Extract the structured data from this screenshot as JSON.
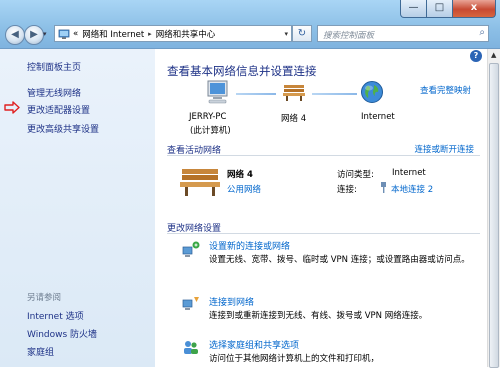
{
  "titlebar": {
    "min_label": "—",
    "max_label": "□",
    "close_label": "x"
  },
  "nav": {
    "back_label": "◀",
    "forward_label": "▶"
  },
  "address": {
    "root_label": "«",
    "segments": [
      "网络和 Internet",
      "网络和共享中心"
    ],
    "separator": "▸",
    "dropdown_label": "▾"
  },
  "refresh_label": "↻",
  "search": {
    "placeholder": "搜索控制面板",
    "icon": "magnifier-icon"
  },
  "sidebar": {
    "items": [
      "控制面板主页",
      "管理无线网络",
      "更改适配器设置",
      "更改高级共享设置"
    ],
    "see_also_title": "另请参阅",
    "see_also": [
      "Internet 选项",
      "Windows 防火墙",
      "家庭组"
    ],
    "arrow_color": "#e02020"
  },
  "main": {
    "title": "查看基本网络信息并设置连接",
    "full_map_link": "查看完整映射",
    "map": {
      "computer": "JERRY-PC",
      "computer_sub": "(此计算机)",
      "network": "网络 4",
      "internet": "Internet"
    },
    "active": {
      "header": "查看活动网络",
      "link": "连接或断开连接",
      "network_name": "网络 4",
      "network_type": "公用网络",
      "access_type_label": "访问类型:",
      "access_type_value": "Internet",
      "connection_label": "连接:",
      "connection_value": "本地连接 2"
    },
    "change": {
      "header": "更改网络设置",
      "tasks": [
        {
          "title": "设置新的连接或网络",
          "desc": "设置无线、宽带、拨号、临时或 VPN 连接；或设置路由器或访问点。"
        },
        {
          "title": "连接到网络",
          "desc": "连接到或重新连接到无线、有线、拨号或 VPN 网络连接。"
        },
        {
          "title": "选择家庭组和共享选项",
          "desc": "访问位于其他网络计算机上的文件和打印机，"
        }
      ]
    }
  },
  "help_label": "?",
  "colors": {
    "link": "#0066cc",
    "heading": "#1e3287",
    "sidebar_bg": "#dbe9f6"
  }
}
